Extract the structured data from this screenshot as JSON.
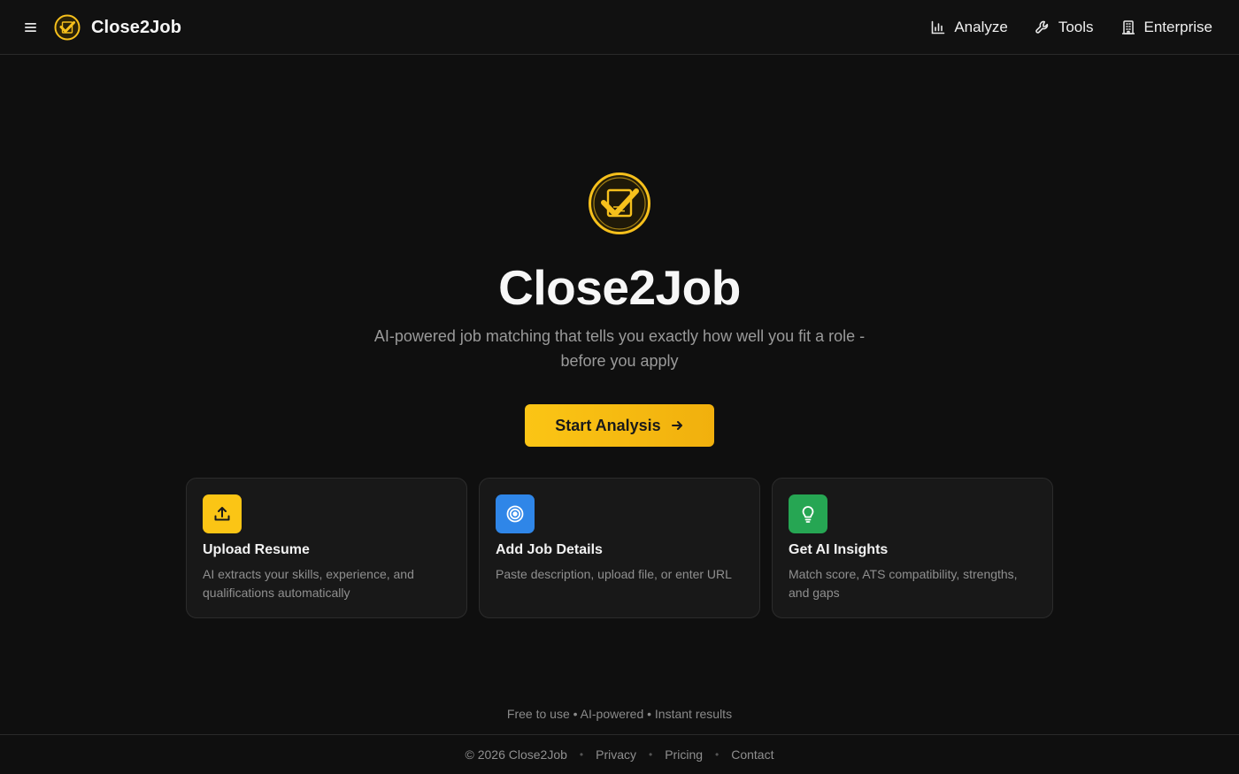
{
  "header": {
    "brand": "Close2Job",
    "nav": [
      {
        "label": "Analyze",
        "icon": "bar-chart-icon"
      },
      {
        "label": "Tools",
        "icon": "wrench-icon"
      },
      {
        "label": "Enterprise",
        "icon": "building-icon"
      }
    ]
  },
  "hero": {
    "title": "Close2Job",
    "subtitle": "AI-powered job matching that tells you exactly how well you fit a role - before you apply",
    "cta_label": "Start Analysis"
  },
  "features": [
    {
      "title": "Upload Resume",
      "description": "AI extracts your skills, experience, and qualifications automatically",
      "icon": "upload-icon",
      "color": "#fbc515"
    },
    {
      "title": "Add Job Details",
      "description": "Paste description, upload file, or enter URL",
      "icon": "target-icon",
      "color": "#2f86e8"
    },
    {
      "title": "Get AI Insights",
      "description": "Match score, ATS compatibility, strengths, and gaps",
      "icon": "lightbulb-icon",
      "color": "#26a653"
    }
  ],
  "tagline": "Free to use • AI-powered • Instant results",
  "footer": {
    "copyright": "© 2026 Close2Job",
    "links": [
      "Privacy",
      "Pricing",
      "Contact"
    ]
  },
  "colors": {
    "accent": "#fbc515",
    "background": "#0f0f0f"
  }
}
